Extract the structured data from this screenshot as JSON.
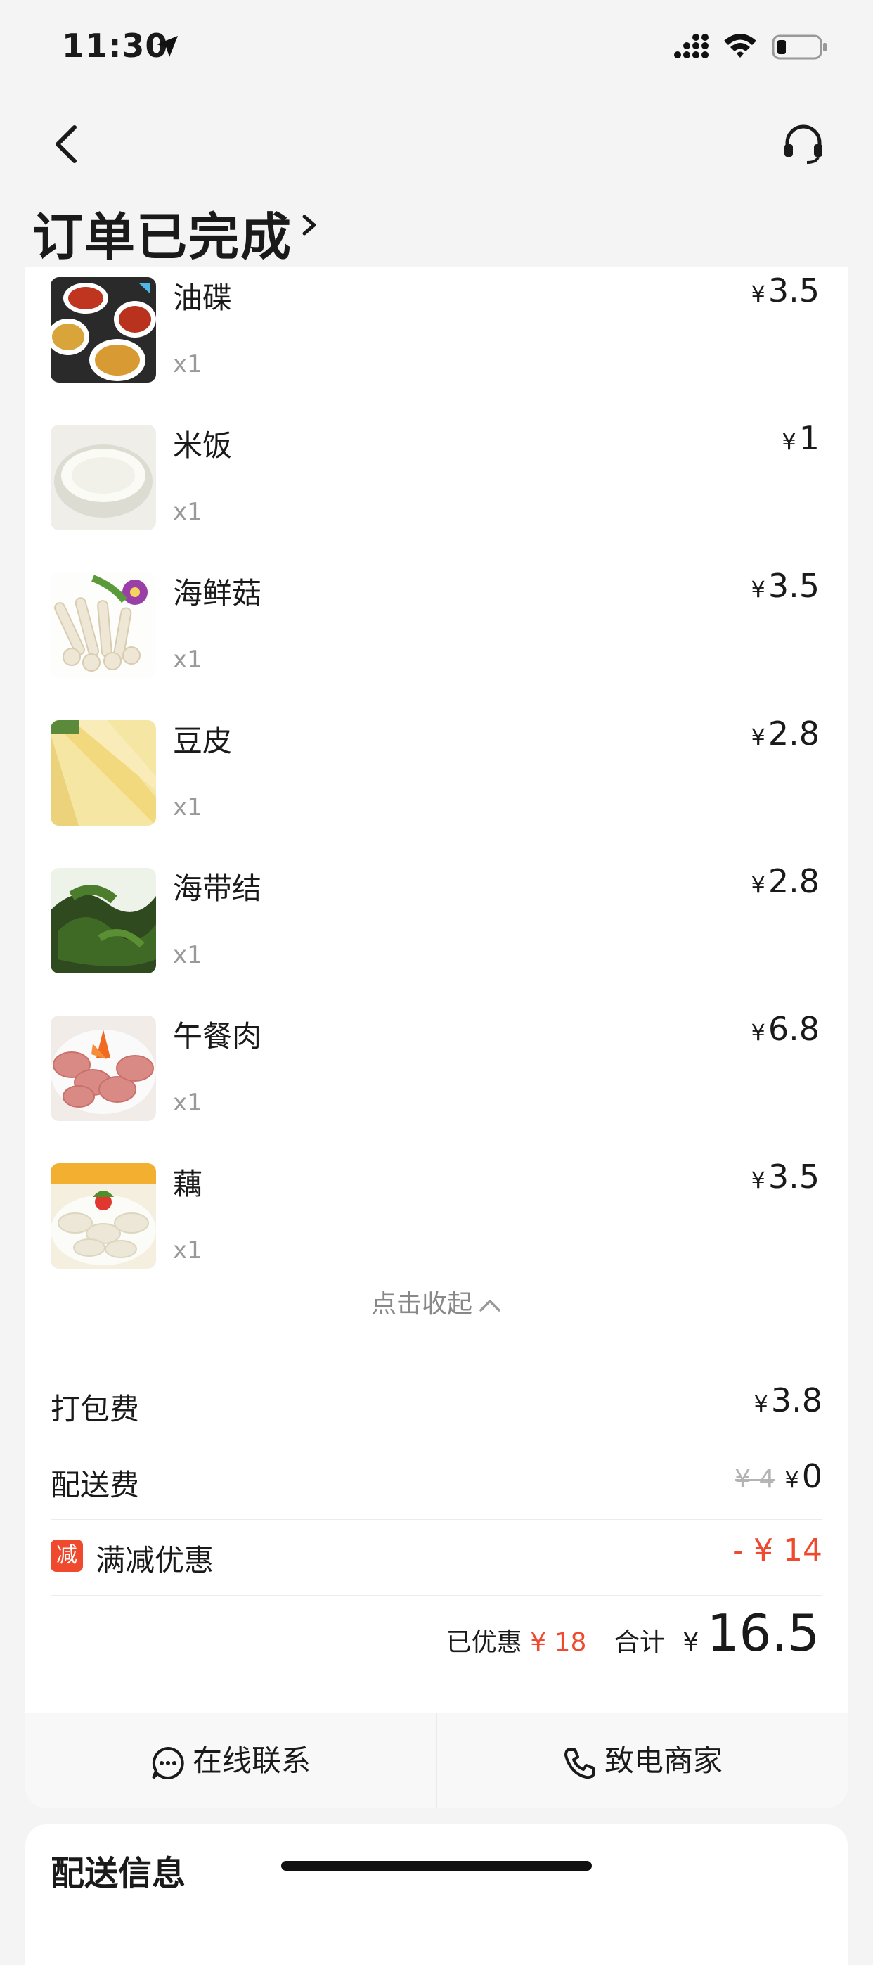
{
  "status_bar": {
    "time": "11:30"
  },
  "header": {
    "title": "订单已完成"
  },
  "items": [
    {
      "name": "油碟",
      "qty": "x1",
      "currency": "¥",
      "price": "3.5",
      "image": "dipping-sauce-photo"
    },
    {
      "name": "米饭",
      "qty": "x1",
      "currency": "¥",
      "price": "1",
      "image": "rice-photo"
    },
    {
      "name": "海鲜菇",
      "qty": "x1",
      "currency": "¥",
      "price": "3.5",
      "image": "seafood-mushroom-photo"
    },
    {
      "name": "豆皮",
      "qty": "x1",
      "currency": "¥",
      "price": "2.8",
      "image": "tofu-skin-photo"
    },
    {
      "name": "海带结",
      "qty": "x1",
      "currency": "¥",
      "price": "2.8",
      "image": "kelp-knot-photo"
    },
    {
      "name": "午餐肉",
      "qty": "x1",
      "currency": "¥",
      "price": "6.8",
      "image": "luncheon-meat-photo"
    },
    {
      "name": "藕",
      "qty": "x1",
      "currency": "¥",
      "price": "3.5",
      "image": "lotus-root-photo"
    }
  ],
  "collapse_label": "点击收起",
  "fees": {
    "packing": {
      "label": "打包费",
      "currency": "¥",
      "value": "3.8"
    },
    "delivery": {
      "label": "配送费",
      "original": "¥ 4",
      "currency": "¥",
      "value": "0"
    },
    "promo": {
      "badge": "减",
      "label": "满减优惠",
      "value": "- ¥ 14"
    }
  },
  "summary": {
    "saved_label": "已优惠",
    "saved_value": "¥ 18",
    "total_label": "合计",
    "currency": "¥",
    "total_value": "16.5"
  },
  "actions": {
    "chat": "在线联系",
    "call": "致电商家"
  },
  "delivery_section": {
    "title": "配送信息"
  },
  "colors": {
    "accent_red": "#f04a2e",
    "background": "#f4f4f4",
    "card": "#ffffff"
  }
}
